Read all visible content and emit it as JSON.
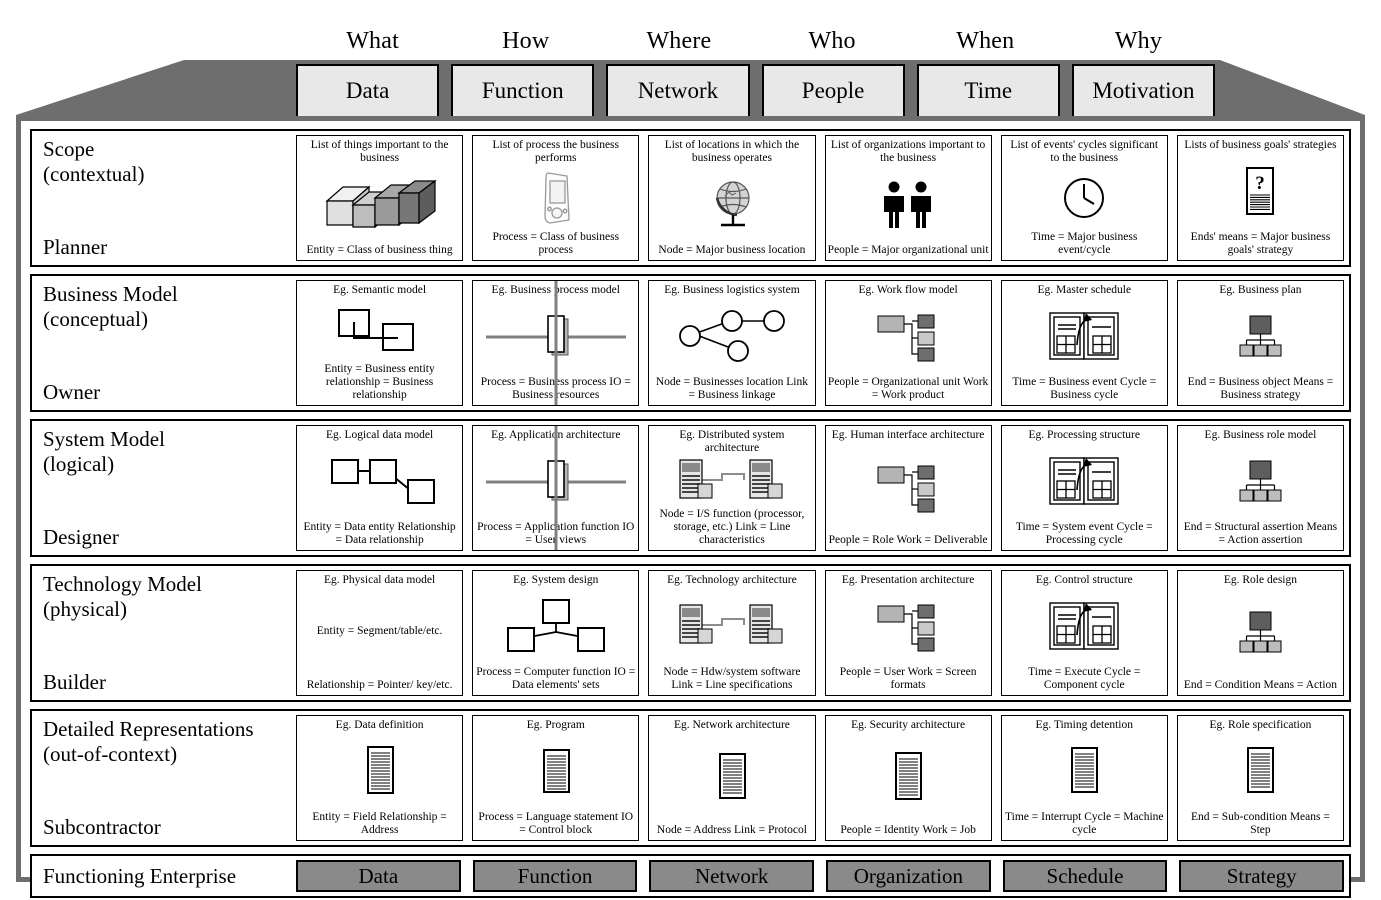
{
  "interrogatives": [
    "What",
    "How",
    "Where",
    "Who",
    "When",
    "Why"
  ],
  "column_headers": [
    "Data",
    "Function",
    "Network",
    "People",
    "Time",
    "Motivation"
  ],
  "footer_headers": [
    "Data",
    "Function",
    "Network",
    "Organization",
    "Schedule",
    "Strategy"
  ],
  "colors": {
    "band": "#6e6e6e",
    "header_cell": "#e8e8e8",
    "footer_cell": "#8a8a8a",
    "frame_border": "#6e6e6e",
    "ink": "#000000"
  },
  "rows": [
    {
      "title": "Scope\n(contextual)",
      "actor": "Planner",
      "cells": [
        {
          "top": "List of things important to the business",
          "icon": "stacked-blocks-icon",
          "bottom": "Entity = Class of business thing"
        },
        {
          "top": "List of process the business performs",
          "icon": "handheld-device-icon",
          "bottom": "Process = Class of business process"
        },
        {
          "top": "List of locations in which the business operates",
          "icon": "globe-icon",
          "bottom": "Node = Major business location"
        },
        {
          "top": "List of organizations important to the business",
          "icon": "two-people-icon",
          "bottom": "People = Major organizational unit"
        },
        {
          "top": "List of events' cycles significant to the business",
          "icon": "clock-icon",
          "bottom": "Time = Major business event/cycle"
        },
        {
          "top": "Lists of business goals' strategies",
          "icon": "question-document-icon",
          "bottom": "Ends' means = Major business goals' strategy"
        }
      ]
    },
    {
      "title": "Business Model\n(conceptual)",
      "actor": "Owner",
      "cells": [
        {
          "top": "Eg. Semantic model",
          "icon": "two-linked-squares-icon",
          "bottom": "Entity = Business entity\nrelationship = Business relationship"
        },
        {
          "top": "Eg. Business process model",
          "icon": "process-crosshair-icon",
          "bottom": "Process = Business process\nIO = Business resources"
        },
        {
          "top": "Eg. Business logistics system",
          "icon": "node-graph-icon",
          "bottom": "Node = Businesses location\nLink = Business linkage"
        },
        {
          "top": "Eg. Work flow model",
          "icon": "org-blocks-icon",
          "bottom": "People = Organizational unit\nWork = Work product"
        },
        {
          "top": "Eg. Master schedule",
          "icon": "open-calendar-icon",
          "bottom": "Time = Business event\nCycle = Business cycle"
        },
        {
          "top": "Eg. Business plan",
          "icon": "hierarchy-icon",
          "bottom": "End = Business object\nMeans = Business strategy"
        }
      ]
    },
    {
      "title": "System Model\n(logical)",
      "actor": "Designer",
      "cells": [
        {
          "top": "Eg. Logical data model",
          "icon": "three-linked-squares-icon",
          "bottom": "Entity = Data entity\nRelationship = Data relationship"
        },
        {
          "top": "Eg. Application architecture",
          "icon": "process-crosshair-icon",
          "bottom": "Process = Application function\nIO = User views"
        },
        {
          "top": "Eg. Distributed system architecture",
          "icon": "two-servers-icon",
          "bottom": "Node = I/S function\n(processor, storage, etc.)\nLink = Line characteristics"
        },
        {
          "top": "Eg. Human interface architecture",
          "icon": "org-blocks-icon",
          "bottom": "People = Role\nWork = Deliverable"
        },
        {
          "top": "Eg. Processing structure",
          "icon": "open-calendar-icon",
          "bottom": "Time = System event\nCycle = Processing cycle"
        },
        {
          "top": "Eg. Business role model",
          "icon": "hierarchy-icon",
          "bottom": "End = Structural assertion\nMeans = Action assertion"
        }
      ]
    },
    {
      "title": "Technology Model\n(physical)",
      "actor": "Builder",
      "cells": [
        {
          "top": "Eg. Physical data model",
          "icon": "none",
          "bottom": "Entity = Segment/table/etc.",
          "middle": "Relationship = Pointer/ key/etc."
        },
        {
          "top": "Eg. System design",
          "icon": "tri-node-tree-icon",
          "bottom": "Process = Computer function\nIO = Data elements' sets"
        },
        {
          "top": "Eg. Technology architecture",
          "icon": "two-servers-icon",
          "bottom": "Node = Hdw/system software\nLink = Line specifications"
        },
        {
          "top": "Eg. Presentation architecture",
          "icon": "org-blocks-icon",
          "bottom": "People = User\nWork = Screen formats"
        },
        {
          "top": "Eg. Control structure",
          "icon": "open-calendar-icon",
          "bottom": "Time = Execute\nCycle = Component cycle"
        },
        {
          "top": "Eg. Role design",
          "icon": "hierarchy-icon",
          "bottom": "End = Condition\nMeans = Action"
        }
      ]
    },
    {
      "title": "Detailed Representations\n(out-of-context)",
      "actor": "Subcontractor",
      "cells": [
        {
          "top": "Eg. Data definition",
          "icon": "document-icon",
          "bottom": "Entity = Field\nRelationship = Address"
        },
        {
          "top": "Eg. Program",
          "icon": "document-icon",
          "bottom": "Process = Language statement\nIO = Control block"
        },
        {
          "top": "Eg. Network architecture",
          "icon": "document-icon",
          "bottom": "Node = Address\nLink = Protocol"
        },
        {
          "top": "Eg. Security architecture",
          "icon": "document-icon",
          "bottom": "People = Identity\nWork = Job"
        },
        {
          "top": "Eg. Timing detention",
          "icon": "document-icon",
          "bottom": "Time = Interrupt\nCycle = Machine cycle"
        },
        {
          "top": "Eg. Role specification",
          "icon": "document-icon",
          "bottom": "End = Sub-condition\nMeans = Step"
        }
      ]
    }
  ],
  "footer_row": {
    "title": "Functioning Enterprise"
  }
}
